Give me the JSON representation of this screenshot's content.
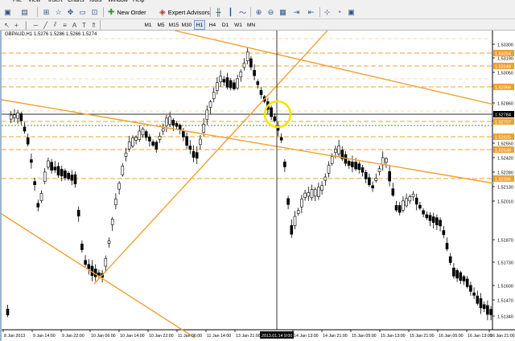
{
  "menu": [
    "File",
    "View",
    "Insert",
    "Charts",
    "Tools",
    "Window",
    "Help"
  ],
  "toolbar": {
    "new_order_label": "New Order",
    "expert_advisors_label": "Expert Advisors",
    "icons": [
      "new-chart-icon",
      "profiles-icon",
      "market-watch-icon",
      "data-window-icon",
      "navigator-icon",
      "terminal-icon",
      "tester-icon",
      "new-order-icon",
      "expert-advisors-icon",
      "bar-chart-icon",
      "candlestick-icon",
      "line-chart-icon",
      "zoom-in-icon",
      "zoom-out-icon",
      "tile-icon",
      "auto-scroll-icon",
      "chart-shift-icon",
      "indicators-icon",
      "periods-icon",
      "templates-icon"
    ]
  },
  "toolbar2": {
    "tools": [
      "cursor-icon",
      "crosshair-icon",
      "vertical-line-icon",
      "horizontal-line-icon",
      "trendline-icon",
      "channel-icon",
      "fibonacci-icon",
      "text-icon",
      "label-icon",
      "arrows-icon"
    ],
    "timeframes": [
      "M1",
      "M5",
      "M15",
      "M30",
      "H1",
      "H4",
      "D1",
      "W1",
      "MN"
    ],
    "active_timeframe": "H1"
  },
  "chart": {
    "symbol_line": "GBPAUD,H1  1.5276 1.5286 1.5266 1.5274",
    "bg_color": "#ffffff",
    "candle_color": "#000000",
    "trendline_color": "#f0a030",
    "highlight_color": "#f2e600",
    "current_price": "1.52784",
    "cursor_time_label": "2013.01.14 9:00",
    "price_ticks": [
      "1.53300",
      "1.53190",
      "1.53050",
      "1.52935",
      "1.52860",
      "1.52700",
      "1.52550",
      "1.52420",
      "1.52280",
      "1.52130",
      "1.52010",
      "1.51870",
      "1.51730",
      "1.51600",
      "1.51470",
      "1.51340"
    ],
    "level_labels": [
      "1.53254",
      "1.53148",
      "1.52966",
      "1.52707",
      "1.52625",
      "1.52538",
      "1.52336"
    ],
    "time_labels": [
      "8 Jan 2013",
      "9 Jan 14:00",
      "9 Jan 22:00",
      "10 Jan 06:00",
      "10 Jan 14:00",
      "10 Jan 22:00",
      "11 Jan 06:00",
      "11 Jan 14:00",
      "13 Jan 21:00",
      "2013.01.14 9:00",
      "14 Jan 13:00",
      "14 Jan 21:00",
      "15 Jan 05:00",
      "15 Jan 13:00",
      "15 Jan 21:00",
      "16 Jan 05:00",
      "16 Jan 13:00",
      "16 Jan 21:00"
    ]
  }
}
